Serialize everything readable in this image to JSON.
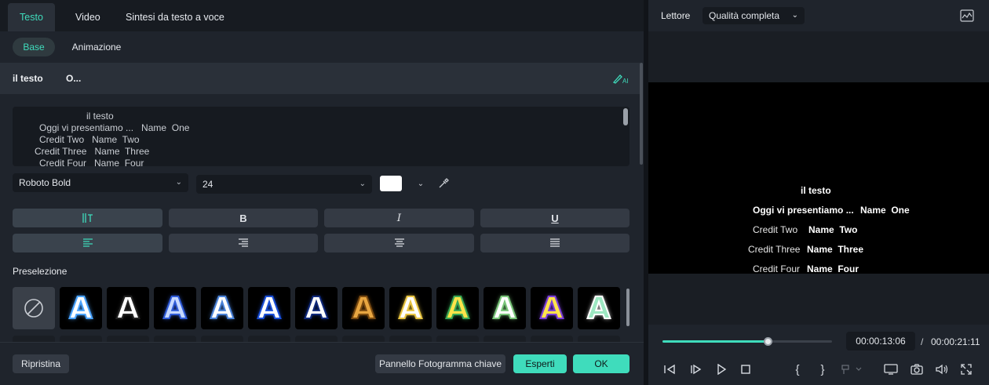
{
  "left": {
    "tabs": [
      {
        "label": "Testo",
        "active": true
      },
      {
        "label": "Video",
        "active": false
      },
      {
        "label": "Sintesi da testo a voce",
        "active": false
      }
    ],
    "subtabs": [
      {
        "label": "Base",
        "active": true
      },
      {
        "label": "Animazione",
        "active": false
      }
    ],
    "section": {
      "title": "il testo",
      "item": "O..."
    },
    "text_content": [
      "il testo",
      "Oggi vi presentiamo ...   Name  One",
      "Credit Two   Name  Two",
      "Credit Three   Name  Three",
      "Credit Four   Name  Four"
    ],
    "font": {
      "family_value": "Roboto Bold",
      "size_value": "24",
      "color": "#ffffff"
    },
    "format_buttons": [
      "B",
      "I",
      "U"
    ],
    "presets_label": "Preselezione",
    "presets": [
      {
        "glyph": "A",
        "fill": "#ffffff",
        "stroke": "#4aa3ff"
      },
      {
        "glyph": "A",
        "fill": "#ffffff",
        "stroke": "#222222"
      },
      {
        "glyph": "A",
        "fill": "#c6d8ff",
        "stroke": "#2f5bd8"
      },
      {
        "glyph": "A",
        "fill": "#ffffff",
        "stroke": "#4a82d8"
      },
      {
        "glyph": "A",
        "fill": "#ffffff",
        "stroke": "#1a4fd8"
      },
      {
        "glyph": "A",
        "fill": "#ffffff",
        "stroke": "#10297a"
      },
      {
        "glyph": "A",
        "fill": "#e8a641",
        "stroke": "#7a4a10"
      },
      {
        "glyph": "A",
        "fill": "#ffffff",
        "stroke": "#e8c441"
      },
      {
        "glyph": "A",
        "fill": "#ffe44a",
        "stroke": "#3aa855"
      },
      {
        "glyph": "A",
        "fill": "#ffffff",
        "stroke": "#7ac67a"
      },
      {
        "glyph": "A",
        "fill": "#ffe44a",
        "stroke": "#7b3fd8"
      },
      {
        "glyph": "A",
        "fill": "#9de8c2",
        "stroke": "#ffffff"
      }
    ],
    "footer": {
      "reset": "Ripristina",
      "keyframe": "Pannello Fotogramma chiave",
      "expert": "Esperti",
      "ok": "OK"
    }
  },
  "right": {
    "title": "Lettore",
    "quality": "Qualità completa",
    "preview_lines": [
      {
        "left": "",
        "right": "il testo"
      },
      {
        "left": "Oggi vi presentiamo ...",
        "right": "Name  One"
      },
      {
        "left": "Credit Two",
        "right": "Name  Two"
      },
      {
        "left": "Credit Three",
        "right": "Name  Three"
      },
      {
        "left": "Credit Four",
        "right": "Name  Four"
      }
    ],
    "progress_fraction": 0.62,
    "current_time": "00:00:13:06",
    "separator": "/",
    "total_time": "00:00:21:11"
  },
  "colors": {
    "accent": "#3fdcbc",
    "panel": "#1f242c",
    "bar": "#2a3039"
  }
}
